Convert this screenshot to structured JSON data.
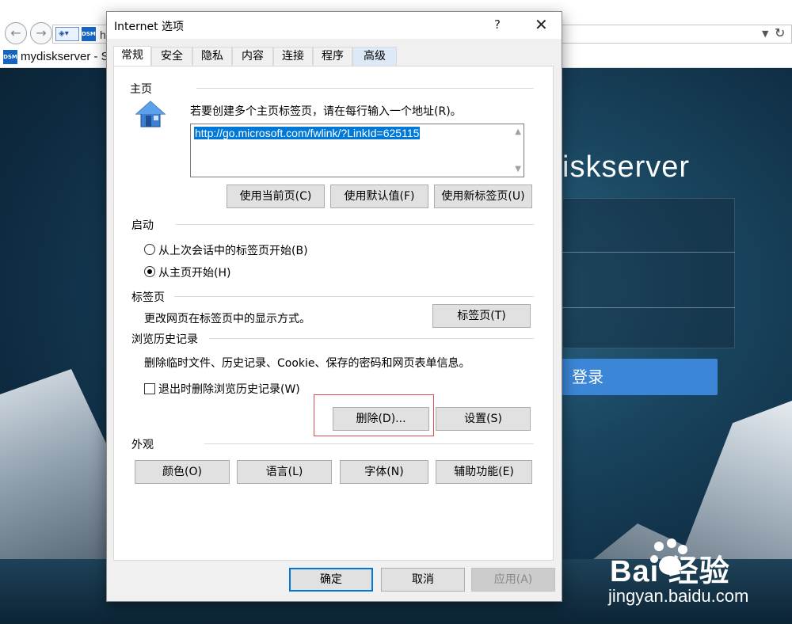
{
  "browser": {
    "address_text": "h",
    "tab_favicon": "DSM",
    "tab_title": "mydiskserver - S",
    "back_icon": "back-arrow-icon",
    "forward_icon": "forward-arrow-icon"
  },
  "page": {
    "login_title": "iskserver",
    "login_button": "登录"
  },
  "watermark": {
    "brand": "Bai  经验",
    "url": "jingyan.baidu.com"
  },
  "dialog": {
    "title": "Internet 选项",
    "help": "?",
    "close": "✕",
    "tabs": [
      "常规",
      "安全",
      "隐私",
      "内容",
      "连接",
      "程序",
      "高级"
    ],
    "homepage": {
      "label": "主页",
      "instruction": "若要创建多个主页标签页，请在每行输入一个地址(R)。",
      "url": "http://go.microsoft.com/fwlink/?LinkId=625115",
      "buttons": [
        "使用当前页(C)",
        "使用默认值(F)",
        "使用新标签页(U)"
      ]
    },
    "startup": {
      "label": "启动",
      "options": [
        "从上次会话中的标签页开始(B)",
        "从主页开始(H)"
      ],
      "selected_index": 1
    },
    "tabs_section": {
      "label": "标签页",
      "description": "更改网页在标签页中的显示方式。",
      "button": "标签页(T)"
    },
    "history": {
      "label": "浏览历史记录",
      "description": "删除临时文件、历史记录、Cookie、保存的密码和网页表单信息。",
      "checkbox_label": "退出时删除浏览历史记录(W)",
      "checkbox_checked": false,
      "delete_button": "删除(D)...",
      "settings_button": "设置(S)"
    },
    "appearance": {
      "label": "外观",
      "buttons": [
        "颜色(O)",
        "语言(L)",
        "字体(N)",
        "辅助功能(E)"
      ]
    },
    "footer": {
      "ok": "确定",
      "cancel": "取消",
      "apply": "应用(A)"
    }
  },
  "colors": {
    "accent": "#0078d7",
    "highlight_outline": "#e04b4b",
    "login_button": "#3b86d6"
  }
}
